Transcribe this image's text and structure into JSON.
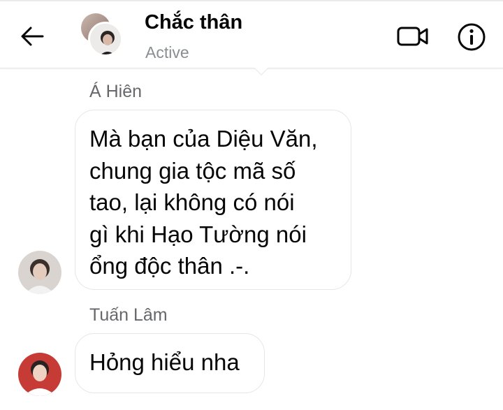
{
  "header": {
    "title": "Chắc thân",
    "status": "Active",
    "back_icon": "arrow-left-icon",
    "video_icon": "video-camera-icon",
    "info_icon": "info-icon"
  },
  "messages": [
    {
      "sender": "Á Hiên",
      "lines": [
        "Mà bạn của Diệu Văn,",
        "chung gia tộc mã số",
        "tao, lại không có nói",
        "gì khi Hạo Tường nói",
        "ổng độc thân .-."
      ]
    },
    {
      "sender": "Tuấn Lâm",
      "lines": [
        "Hỏng hiểu nha"
      ]
    }
  ],
  "colors": {
    "text": "#050505",
    "secondary_text": "#65676b",
    "status_text": "#8a8d91",
    "bubble_border": "#e4e6eb"
  }
}
